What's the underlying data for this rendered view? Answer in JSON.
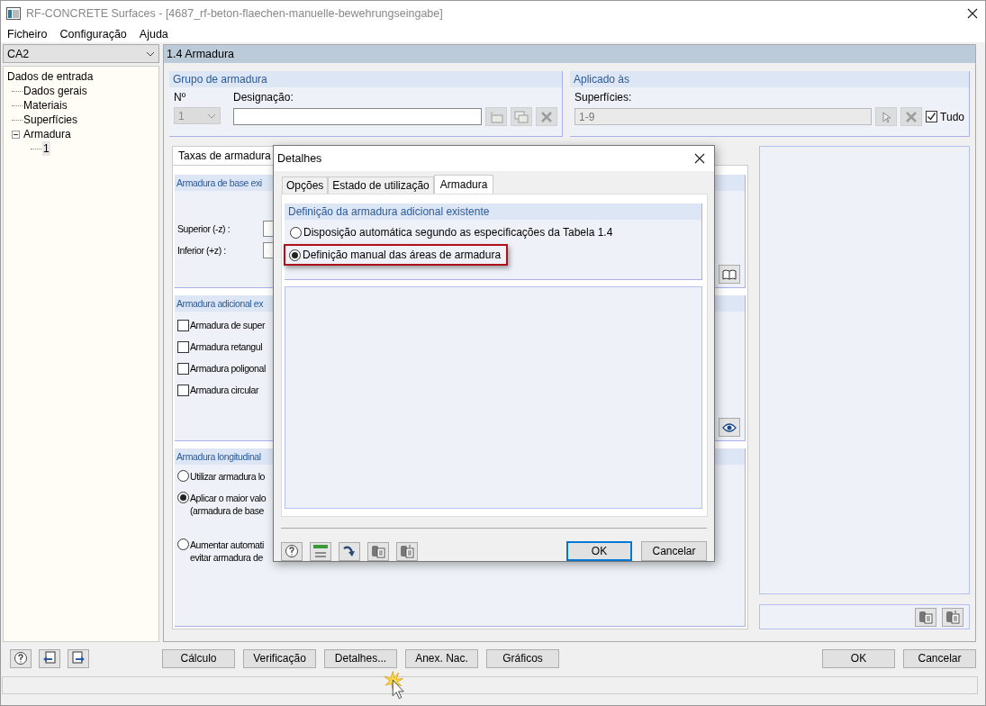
{
  "window": {
    "title": "RF-CONCRETE Surfaces - [4687_rf-beton-flaechen-manuelle-bewehrungseingabe]"
  },
  "menu": [
    "Ficheiro",
    "Configuração",
    "Ajuda"
  ],
  "case_select": {
    "value": "CA2"
  },
  "tree": [
    {
      "label": "Dados de entrada",
      "selected": false,
      "children": [
        {
          "label": "Dados gerais",
          "selected": false
        },
        {
          "label": "Materiais",
          "selected": false
        },
        {
          "label": "Superfícies",
          "selected": false
        },
        {
          "label": "Armadura",
          "selected": false,
          "expanded": true,
          "children": [
            {
              "label": "1",
              "selected": true
            }
          ]
        }
      ]
    }
  ],
  "panel_title": "1.4 Armadura",
  "reinforcement_group": {
    "title": "Grupo de armadura",
    "number_label": "Nº",
    "number": "1",
    "designation_label": "Designação:"
  },
  "applied_to": {
    "title": "Aplicado às",
    "surfaces_label": "Superfícies:",
    "surfaces": "1-9",
    "all_label": "Tudo",
    "all_checked": true
  },
  "tabs": [
    {
      "label": "Taxas de armadura",
      "selected": true
    }
  ],
  "basic_reinforcement": {
    "title": "Armadura de base exi",
    "rows": [
      "Superior (-z) :",
      "Inferior (+z) :"
    ]
  },
  "additional_reinforcement": {
    "title": "Armadura adicional ex",
    "options": [
      {
        "label": "Armadura de super",
        "checked": false
      },
      {
        "label": "Armadura retangul",
        "checked": false
      },
      {
        "label": "Armadura poligonal",
        "checked": false
      },
      {
        "label": "Armadura circular",
        "checked": false
      }
    ]
  },
  "longitudinal": {
    "title": "Armadura longitudinal",
    "options": [
      {
        "lines": [
          "Utilizar armadura lo"
        ],
        "selected": false
      },
      {
        "lines": [
          "Aplicar o maior valo",
          "(armadura de base"
        ],
        "selected": true
      },
      {
        "lines": [
          "Aumentar automati",
          "evitar armadura de"
        ],
        "selected": false
      }
    ]
  },
  "footer": {
    "buttons": [
      "Cálculo",
      "Verificação",
      "Detalhes...",
      "Anex. Nac.",
      "Gráficos"
    ],
    "ok": "OK",
    "cancel": "Cancelar"
  },
  "dialog": {
    "title": "Detalhes",
    "tabs": [
      {
        "label": "Opções",
        "selected": false
      },
      {
        "label": "Estado de utilização",
        "selected": false
      },
      {
        "label": "Armadura",
        "selected": true
      }
    ],
    "group_title": "Definição da armadura adicional existente",
    "options": [
      {
        "label": "Disposição automática segundo as especificações da Tabela 1.4",
        "selected": false,
        "highlighted": false
      },
      {
        "label": "Definição manual das áreas de armadura",
        "selected": true,
        "highlighted": true
      }
    ],
    "buttons": [
      {
        "label": "OK",
        "default": true
      },
      {
        "label": "Cancelar",
        "default": false
      }
    ]
  }
}
